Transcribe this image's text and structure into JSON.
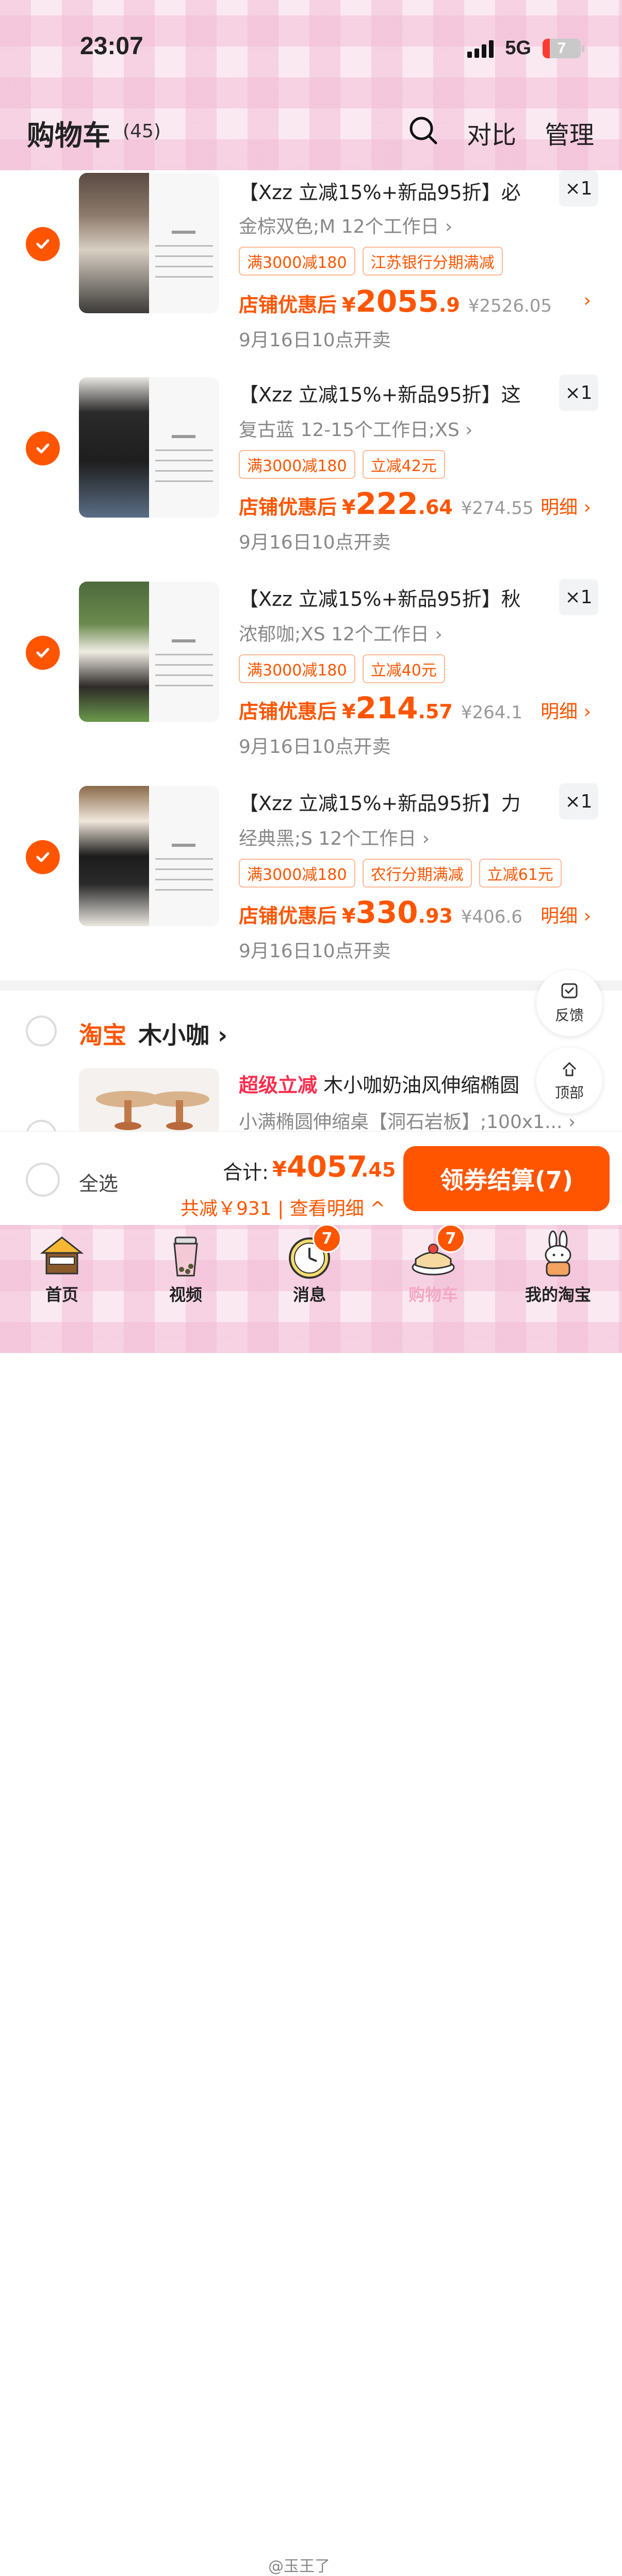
{
  "status": {
    "time": "23:07",
    "network": "5G",
    "battery": "7"
  },
  "header": {
    "title": "购物车",
    "count": "(45)",
    "compare": "对比",
    "manage": "管理"
  },
  "items": [
    {
      "title": "【Xzz 立减15%+新品95折】必",
      "sku": "金棕双色;M 12个工作日 ›",
      "tags": [
        "满3000减180",
        "江苏银行分期满减"
      ],
      "price_label": "店铺优惠后",
      "price_int": "2055",
      "price_dec": ".9",
      "orig": "¥2526.05",
      "detail": "›",
      "qty": "×1",
      "sale": "9月16日10点开卖"
    },
    {
      "title": "【Xzz 立减15%+新品95折】这",
      "sku": "复古蓝 12-15个工作日;XS ›",
      "tags": [
        "满3000减180",
        "立减42元"
      ],
      "price_label": "店铺优惠后",
      "price_int": "222",
      "price_dec": ".64",
      "orig": "¥274.55",
      "detail": "明细 ›",
      "qty": "×1",
      "sale": "9月16日10点开卖"
    },
    {
      "title": "【Xzz 立减15%+新品95折】秋",
      "sku": "浓郁咖;XS 12个工作日 ›",
      "tags": [
        "满3000减180",
        "立减40元"
      ],
      "price_label": "店铺优惠后",
      "price_int": "214",
      "price_dec": ".57",
      "orig": "¥264.1",
      "detail": "明细 ›",
      "qty": "×1",
      "sale": "9月16日10点开卖"
    },
    {
      "title": "【Xzz 立减15%+新品95折】力",
      "sku": "经典黑;S 12个工作日 ›",
      "tags": [
        "满3000减180",
        "农行分期满减",
        "立减61元"
      ],
      "price_label": "店铺优惠后",
      "price_int": "330",
      "price_dec": ".93",
      "orig": "¥406.6",
      "detail": "明细 ›",
      "qty": "×1",
      "sale": "9月16日10点开卖"
    }
  ],
  "store2": {
    "logo": "淘宝",
    "name": "木小咖 ›",
    "super_label": "超级立减",
    "title": "木小咖奶油风伸缩椭圆",
    "sku": "小满椭圆伸缩桌【洞石岩板】;100x1... ›"
  },
  "float": {
    "feedback": "反馈",
    "top": "顶部"
  },
  "checkout": {
    "select_all": "全选",
    "total_label": "合计:",
    "yen": "¥",
    "total_int": "4057",
    "total_dec": ".45",
    "saved": "共减￥931 | 查看明细 ^",
    "button": "领券结算(7)"
  },
  "tabs": [
    {
      "label": "首页",
      "icon": "home-house-icon"
    },
    {
      "label": "视频",
      "icon": "bubble-tea-icon"
    },
    {
      "label": "消息",
      "icon": "clock-icon",
      "badge": "7"
    },
    {
      "label": "购物车",
      "icon": "cake-icon",
      "badge": "7",
      "active": true
    },
    {
      "label": "我的淘宝",
      "icon": "bunny-icon"
    }
  ],
  "watermark": "@玉王了",
  "colors": {
    "accent": "#ff5500",
    "tab_active": "#f4a6c3",
    "super": "#ff2c4d"
  }
}
